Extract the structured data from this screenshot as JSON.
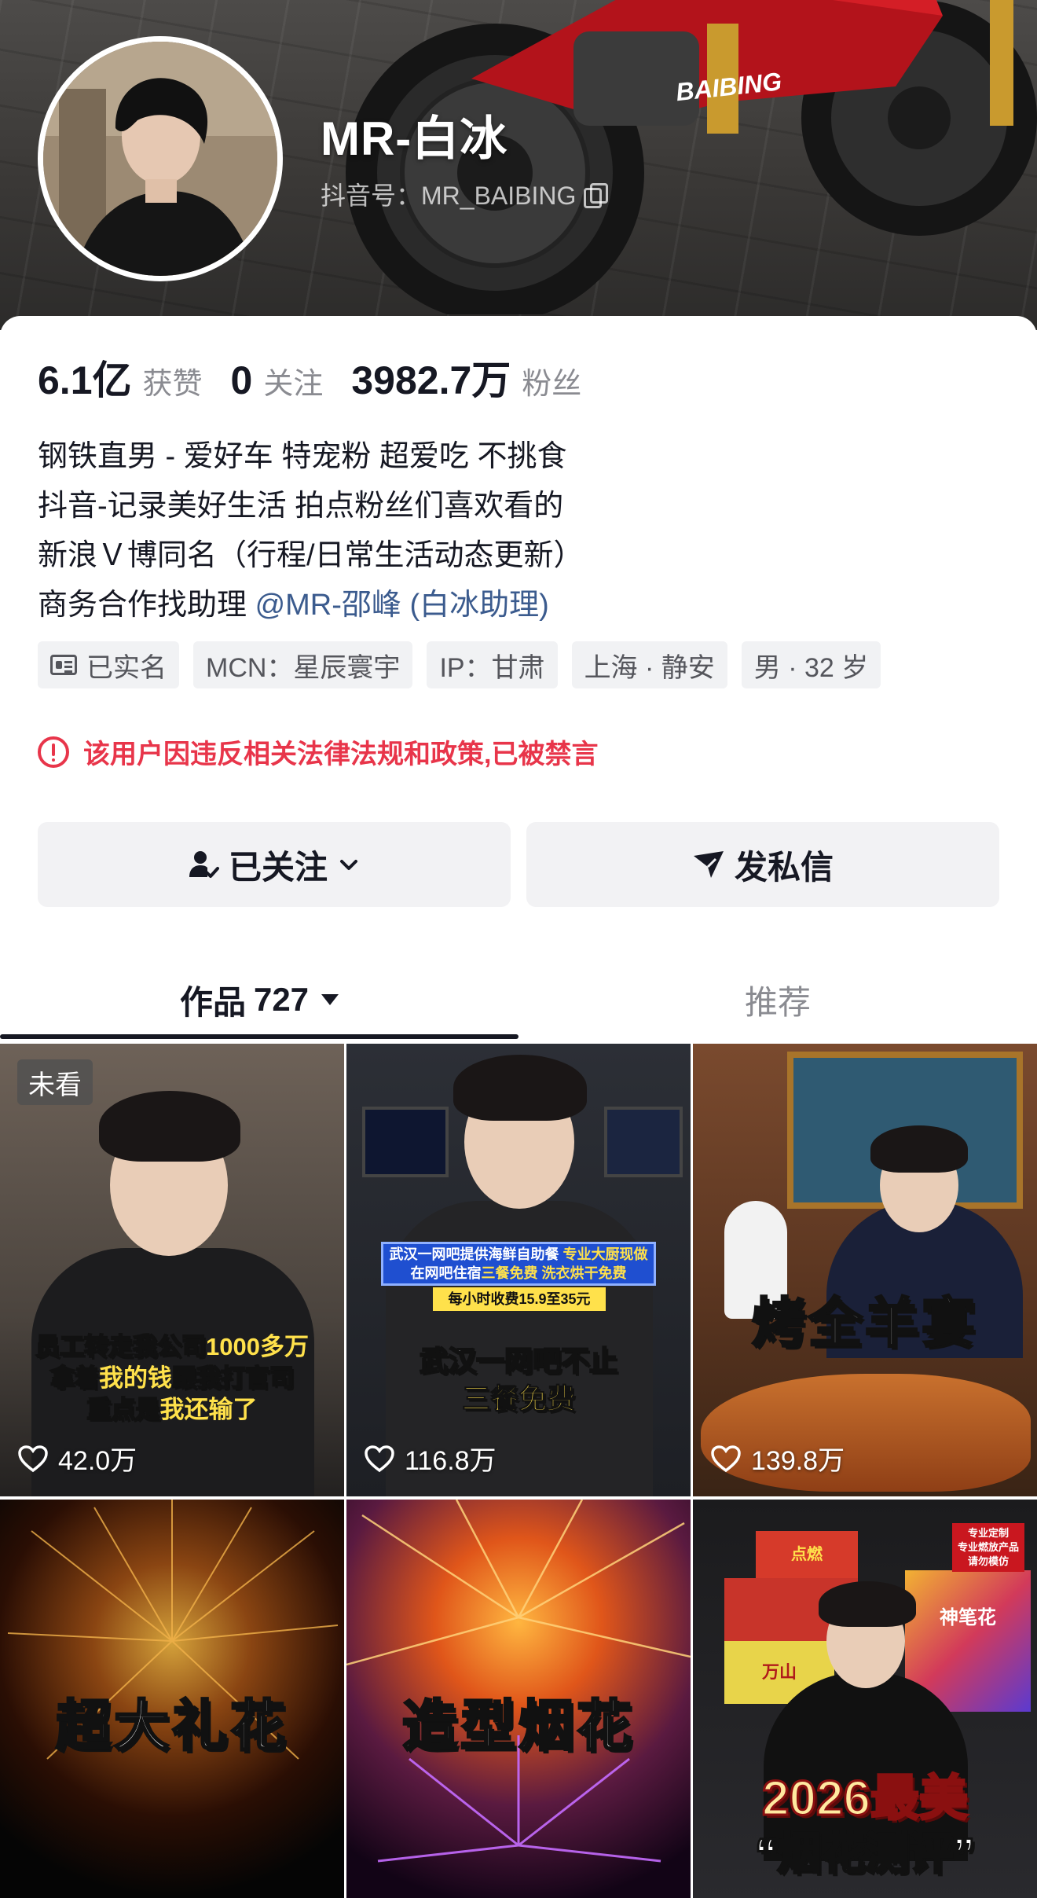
{
  "profile": {
    "name": "MR-白冰",
    "douyin_id": "抖音号：MR_BAIBING",
    "bike_brand": "BAIBING"
  },
  "stats": [
    {
      "value": "6.1亿",
      "label": "获赞"
    },
    {
      "value": "0",
      "label": "关注"
    },
    {
      "value": "3982.7万",
      "label": "粉丝"
    }
  ],
  "bio": {
    "line1": "钢铁直男 - 爱好车 特宠粉 超爱吃 不挑食",
    "line2": "抖音-记录美好生活 拍点粉丝们喜欢看的",
    "line3": "新浪Ｖ博同名（行程/日常生活动态更新）",
    "line4_prefix": "商务合作找助理 ",
    "line4_mention": "@MR-邵峰 (白冰助理)"
  },
  "tags": [
    "已实名",
    "MCN：星辰寰宇",
    "IP：甘肃",
    "上海 · 静安",
    "男 · 32 岁"
  ],
  "ban_notice": "该用户因违反相关法律法规和政策,已被禁言",
  "actions": {
    "follow": "已关注",
    "message": "发私信"
  },
  "tabs": {
    "works_label": "作品",
    "works_count": "727",
    "recommend": "推荐"
  },
  "videos": [
    {
      "badge": "未看",
      "likes": "42.0万",
      "caption_l1a": "员工转走我公司",
      "caption_l1b": "1000多万",
      "caption_l2a": "拿着",
      "caption_l2b": "我的钱",
      "caption_l2c": "跟我打官司",
      "caption_l3a": "重点是",
      "caption_l3b": "我还输了"
    },
    {
      "likes": "116.8万",
      "banner1a": "武汉一网吧提供海鲜自助餐",
      "banner1b": "专业大厨现做",
      "banner2a": "在网吧住宿",
      "banner2b": "三餐免费",
      "banner2c": "洗衣烘干免费",
      "banner3": "每小时收费15.9至35元",
      "caption1": "武汉一网吧不止",
      "caption2": "三餐免费"
    },
    {
      "likes": "139.8万",
      "headline": "烤全羊宴"
    },
    {
      "headline": "超大礼花"
    },
    {
      "headline": "造型烟花"
    },
    {
      "headline1": "2026最美",
      "headline2": "“烟花测评”",
      "sign1": "专业定制",
      "sign2": "专业燃放产品",
      "sign3": "请勿模仿",
      "box1": "点燃",
      "box2": "神笔花",
      "box3": "万山"
    }
  ],
  "colors": {
    "ban_red": "#e8354a",
    "mention_blue": "#3b5b8e",
    "text_primary": "#161823",
    "text_secondary": "#8a8b91",
    "highlight_yellow": "#ffe14b"
  }
}
